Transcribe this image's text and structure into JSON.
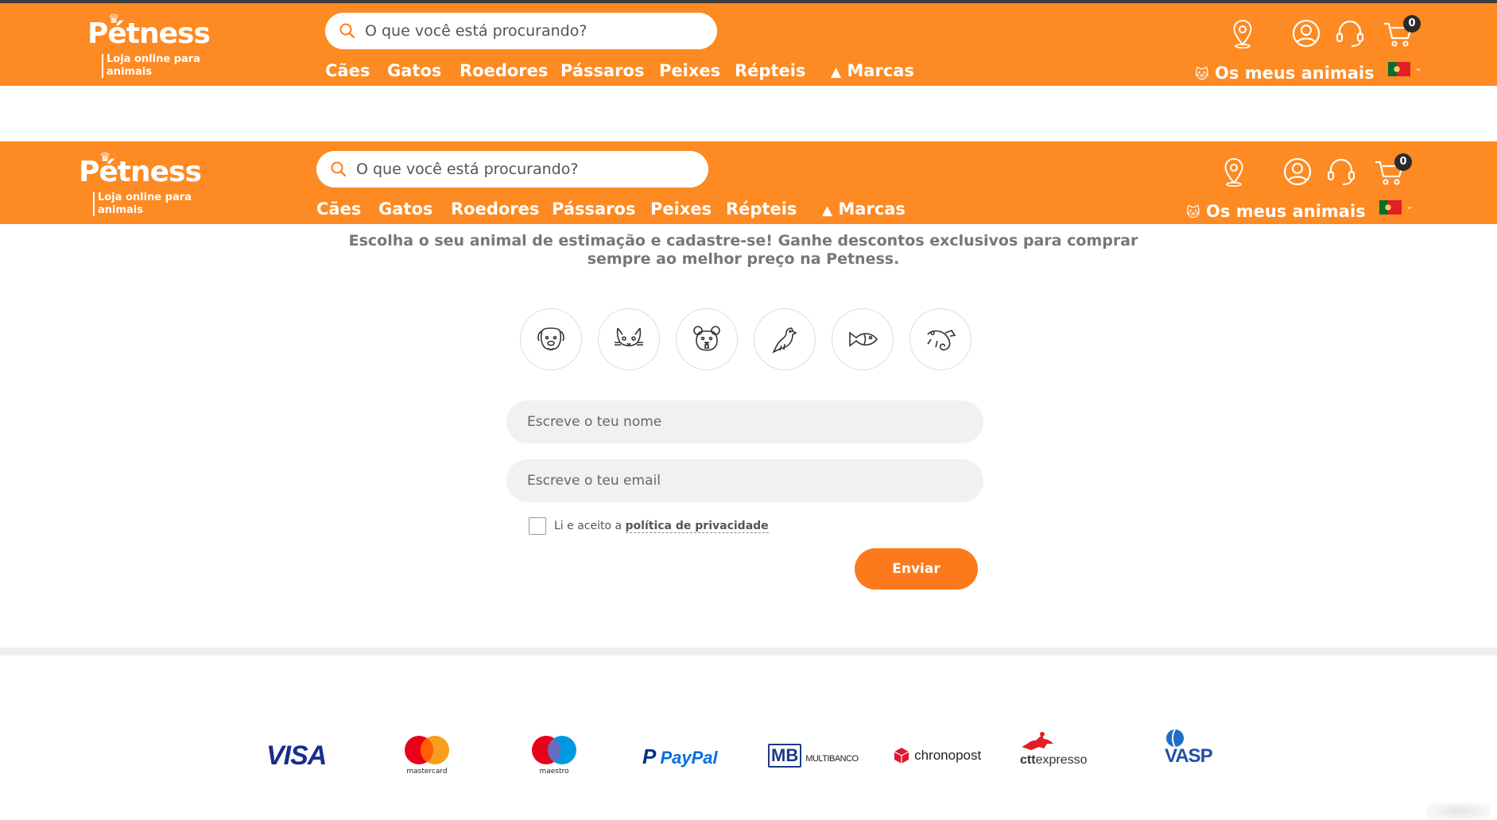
{
  "header": {
    "brand": "Pétness",
    "tagline": "Loja online para animais",
    "search_placeholder": "O que você está procurando?",
    "nav": [
      "Cães",
      "Gatos",
      "Roedores",
      "Pássaros",
      "Peixes",
      "Répteis",
      "Marcas"
    ],
    "my_animals": "Os meus animais",
    "cart_count": "0",
    "icons": [
      "store-locator-icon",
      "account-icon",
      "support-headset-icon",
      "cart-icon"
    ],
    "language_flag": "portugal-flag-icon",
    "accent": "#fd8a22"
  },
  "main": {
    "intro": "Escolha o seu animal de estimação e cadastre-se! Ganhe descontos exclusivos para comprar sempre ao melhor preço na Petness.",
    "pets": [
      "dog-icon",
      "cat-icon",
      "rodent-icon",
      "bird-icon",
      "fish-icon",
      "reptile-icon"
    ],
    "name_placeholder": "Escreve o teu nome",
    "email_placeholder": "Escreve o teu email",
    "consent_text": "Li e aceito a",
    "consent_link": "política de privacidade",
    "submit_label": "Enviar"
  },
  "footer": {
    "payments": {
      "visa": "VISA",
      "mastercard": "mastercard",
      "maestro": "maestro",
      "paypal": "PayPal",
      "multibanco_mb": "MB",
      "multibanco": "MULTIBANCO",
      "chronopost": "chronopost",
      "ctt": "ctt",
      "ctt_suffix": "expresso",
      "vasp": "VASP"
    }
  }
}
